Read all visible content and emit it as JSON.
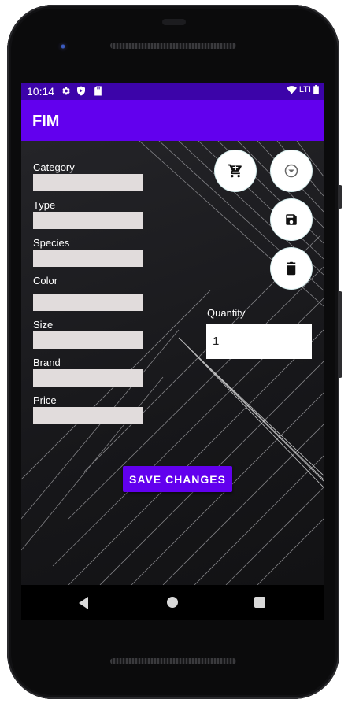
{
  "status_bar": {
    "time": "10:14",
    "icons": [
      "settings-gear-icon",
      "play-protect-icon",
      "sd-card-icon",
      "wifi-icon",
      "battery-icon"
    ],
    "network": "LTI"
  },
  "app_bar": {
    "title": "FIM"
  },
  "form": {
    "fields": [
      {
        "label": "Category",
        "value": ""
      },
      {
        "label": "Type",
        "value": ""
      },
      {
        "label": "Species",
        "value": ""
      },
      {
        "label": "Color",
        "value": ""
      },
      {
        "label": "Size",
        "value": ""
      },
      {
        "label": "Brand",
        "value": ""
      },
      {
        "label": "Price",
        "value": ""
      }
    ],
    "quantity": {
      "label": "Quantity",
      "value": "1"
    }
  },
  "actions": {
    "cart_icon": "shopping-cart-icon",
    "dropdown_icon": "arrow-drop-down-circle-icon",
    "save_icon": "save-floppy-icon",
    "delete_icon": "trash-icon",
    "save_changes_label": "SAVE CHANGES"
  },
  "colors": {
    "status_bar": "#3c04a9",
    "app_bar": "#6200ee",
    "accent_button": "#6200ee",
    "input_background": "#e1dcdc"
  }
}
